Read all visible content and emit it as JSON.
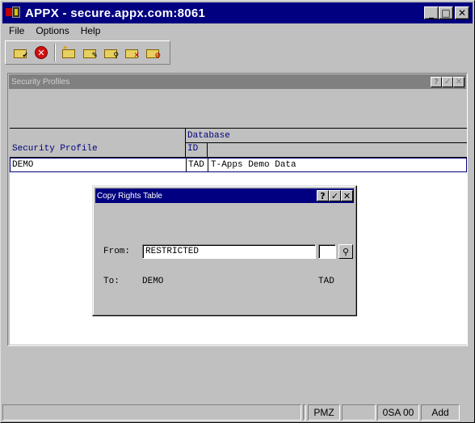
{
  "window": {
    "title": "APPX - secure.appx.com:8061",
    "buttons": {
      "minimize": "_",
      "maximize": "□",
      "close": "✕"
    }
  },
  "menu": [
    "File",
    "Options",
    "Help"
  ],
  "toolbar": [
    {
      "name": "ok-check-icon",
      "glyph": "✔"
    },
    {
      "name": "cancel-icon",
      "glyph": "✕"
    },
    {
      "name": "folder-new-icon",
      "glyph": "✦"
    },
    {
      "name": "folder-edit-icon",
      "glyph": "✎"
    },
    {
      "name": "folder-inquire-icon",
      "glyph": "⚲"
    },
    {
      "name": "folder-delete-icon",
      "glyph": "✕"
    },
    {
      "name": "folder-cancel-icon",
      "glyph": "⊘"
    }
  ],
  "panel": {
    "title": "Security Profiles",
    "buttons": {
      "help": "?",
      "ok": "✓",
      "close": "✕"
    },
    "columns": {
      "profile": "Security Profile",
      "database_group": "Database",
      "db_id": "ID"
    },
    "rows": [
      {
        "profile": "DEMO",
        "db_id": "TAD",
        "db_name": "T-Apps Demo Data"
      }
    ]
  },
  "dialog": {
    "title": "Copy Rights Table",
    "buttons": {
      "help": "?",
      "ok": "✓",
      "close": "✕"
    },
    "from_label": "From:",
    "from_value": "RESTRICTED",
    "from_db_value": "",
    "to_label": "To:",
    "to_profile": "DEMO",
    "to_db": "TAD",
    "lookup_glyph": "⚲"
  },
  "status": [
    "",
    "",
    "PMZ",
    "",
    "0SA 00",
    "Add"
  ]
}
